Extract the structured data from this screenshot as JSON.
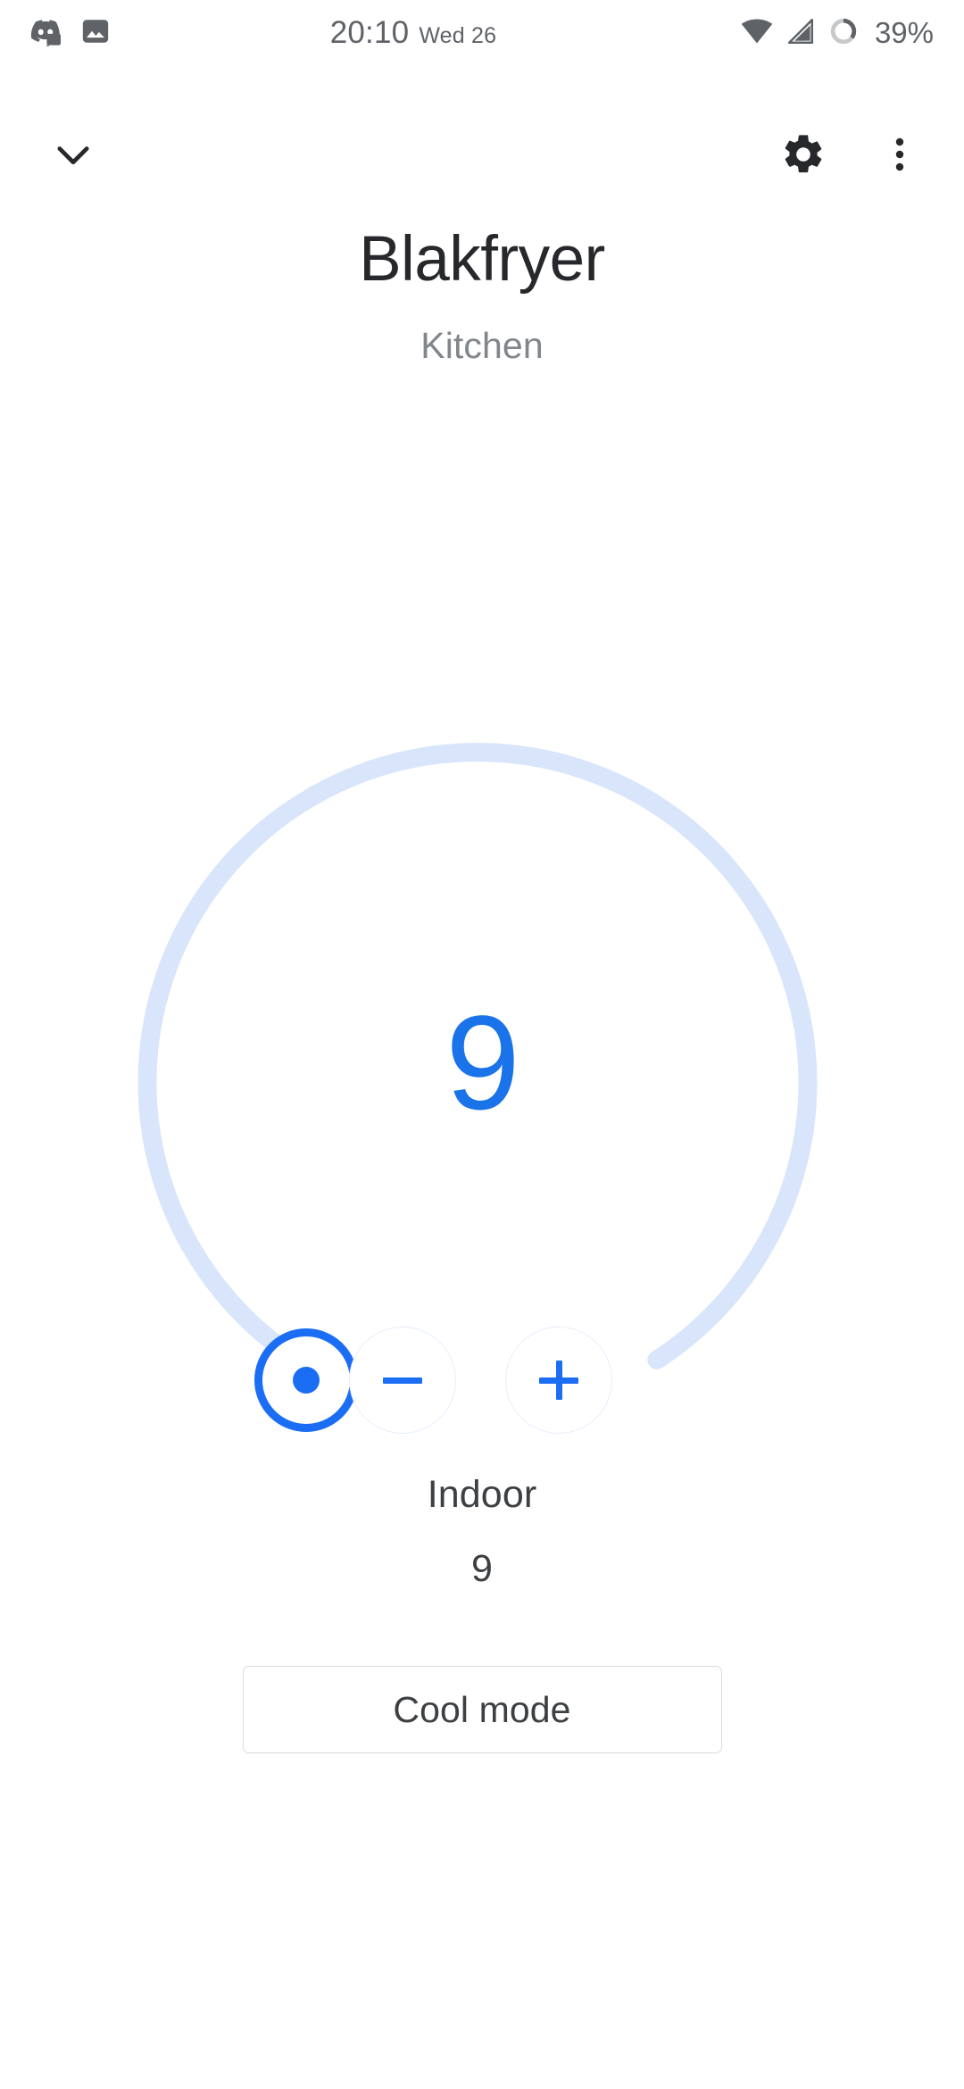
{
  "status_bar": {
    "notifications": [
      {
        "icon": "discord-notification-icon"
      },
      {
        "icon": "image-notification-icon"
      }
    ],
    "time": "20:10",
    "date": "Wed 26",
    "wifi_icon": "wifi-icon",
    "signal_icon": "cellular-signal-icon",
    "battery_icon": "battery-ring-icon",
    "battery_level": "39%",
    "battery_percent": 39
  },
  "app_bar": {
    "collapse_icon": "chevron-down-icon",
    "collapse_label": "Collapse",
    "settings_icon": "gear-icon",
    "settings_label": "Settings",
    "overflow_icon": "more-vertical-icon",
    "overflow_label": "More options"
  },
  "header": {
    "title": "Blakfryer",
    "room": "Kitchen"
  },
  "thermostat": {
    "setpoint": "9",
    "dial": {
      "track_color": "#d8e5fb",
      "accent_color": "#1b6ef3",
      "handle_icon": "dial-handle-icon",
      "start_angle_deg": 216,
      "sweep_deg": 288
    },
    "decrease_icon": "minus-icon",
    "decrease_label": "Decrease temperature",
    "increase_icon": "plus-icon",
    "increase_label": "Increase temperature",
    "current": {
      "label": "Indoor",
      "value": "9"
    },
    "mode_label": "Cool mode"
  },
  "colors": {
    "accent_blue": "#1b6ef3",
    "setpoint_blue": "#1a73e8",
    "arc_light_blue": "#d8e5fb",
    "text_primary": "#26282b",
    "text_secondary": "#3c4043",
    "text_muted": "#80868b",
    "status_gray": "#5f6368",
    "border_gray": "#dadce0"
  }
}
